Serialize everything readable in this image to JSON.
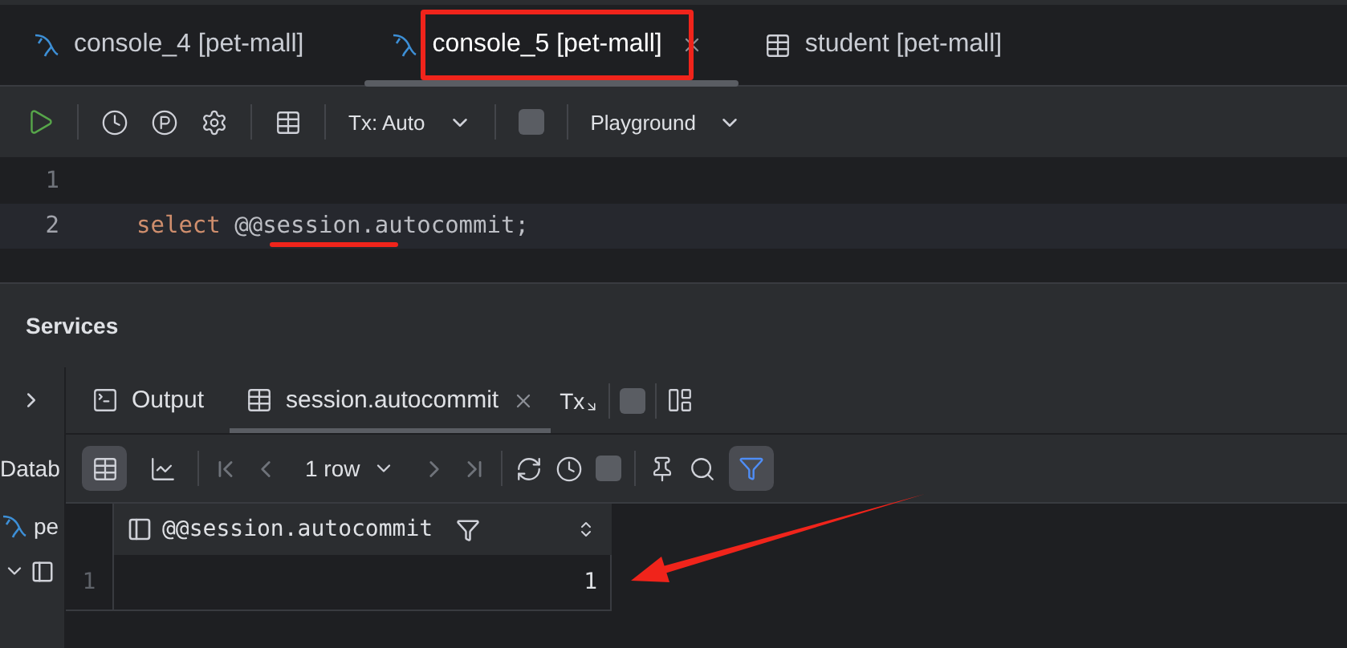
{
  "editor_tabs": [
    {
      "label": "console_4 [pet-mall]",
      "kind": "console",
      "selected": false,
      "closable": false
    },
    {
      "label": "console_5 [pet-mall]",
      "kind": "console",
      "selected": true,
      "closable": true
    },
    {
      "label": "student [pet-mall]",
      "kind": "table",
      "selected": false,
      "closable": false
    }
  ],
  "toolbar": {
    "transaction_mode": "Tx: Auto",
    "schema": "Playground"
  },
  "editor": {
    "lines": [
      {
        "number": "1",
        "current": false
      },
      {
        "number": "2",
        "current": true,
        "tokens": [
          {
            "kind": "keyword",
            "text": "select"
          },
          {
            "kind": "plain",
            "text": " @@session.autocommit;"
          }
        ]
      }
    ]
  },
  "services": {
    "title": "Services",
    "sidebar": [
      {
        "kind": "chevron"
      },
      {
        "kind": "text",
        "text": "Datab"
      },
      {
        "kind": "dolphin",
        "text": "pe"
      },
      {
        "kind": "node"
      }
    ],
    "tabs": [
      {
        "label": "Output",
        "kind": "output",
        "selected": false,
        "closable": false
      },
      {
        "label": "session.autocommit",
        "kind": "table",
        "selected": true,
        "closable": true
      }
    ],
    "tx_label": "Tx",
    "views": [
      {
        "kind": "grid",
        "selected": true
      },
      {
        "kind": "chart",
        "selected": false
      }
    ],
    "row_count": "1 row",
    "filter_selected": true,
    "table": {
      "columns": [
        "@@session.autocommit"
      ],
      "rows": [
        {
          "number": "1",
          "cells": [
            "1"
          ]
        }
      ]
    }
  },
  "annotations": [
    {
      "kind": "box"
    },
    {
      "kind": "underline"
    },
    {
      "kind": "arrow"
    }
  ]
}
